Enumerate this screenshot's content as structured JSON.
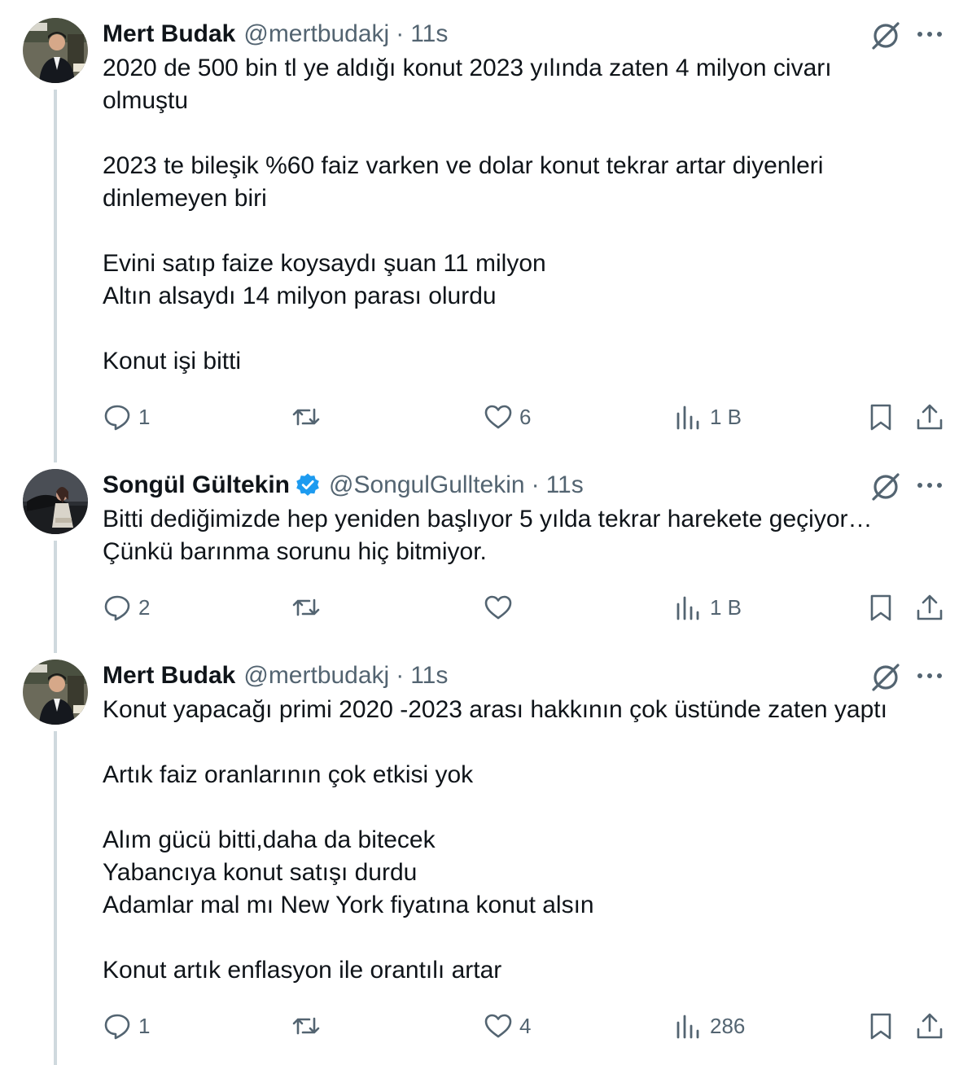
{
  "tweets": [
    {
      "name": "Mert Budak",
      "handle": "@mertbudakj",
      "sep": "·",
      "time": "11s",
      "verified": false,
      "lines": [
        "2020 de 500 bin tl ye aldığı konut 2023 yılında zaten 4 milyon civarı",
        "olmuştu",
        "",
        "2023 te bileşik %60 faiz varken ve dolar konut tekrar artar diyenleri",
        "dinlemeyen biri",
        "",
        "Evini satıp faize koysaydı şuan 11 milyon",
        "Altın alsaydı 14 milyon parası olurdu",
        "",
        "Konut işi bitti"
      ],
      "replies": "1",
      "reposts": "",
      "likes": "6",
      "views": "1 B"
    },
    {
      "name": "Songül Gültekin",
      "handle": "@SongulGulltekin",
      "sep": "·",
      "time": "11s",
      "verified": true,
      "lines": [
        "Bitti dediğimizde hep yeniden başlıyor 5 yılda tekrar harekete geçiyor…",
        "Çünkü barınma sorunu hiç bitmiyor."
      ],
      "replies": "2",
      "reposts": "",
      "likes": "",
      "views": "1 B"
    },
    {
      "name": "Mert Budak",
      "handle": "@mertbudakj",
      "sep": "·",
      "time": "11s",
      "verified": false,
      "lines": [
        "Konut yapacağı primi 2020 -2023 arası hakkının çok üstünde zaten yaptı",
        "",
        "Artık faiz oranlarının çok etkisi yok",
        "",
        "Alım gücü bitti,daha da bitecek",
        "Yabancıya konut satışı durdu",
        "Adamlar mal mı New York fiyatına konut alsın",
        "",
        "Konut artık enflasyon ile orantılı artar"
      ],
      "replies": "1",
      "reposts": "",
      "likes": "4",
      "views": "286"
    }
  ],
  "icons": {
    "reply": "reply-icon",
    "repost": "repost-icon",
    "like": "like-icon",
    "views": "views-icon",
    "bookmark": "bookmark-icon",
    "share": "share-icon",
    "grok": "grok-icon",
    "more": "more-icon",
    "verified": "verified-badge-icon"
  },
  "colors": {
    "text": "#0f1419",
    "secondary": "#536471",
    "thread_line": "#cfd9de",
    "verified": "#1d9bf0"
  }
}
